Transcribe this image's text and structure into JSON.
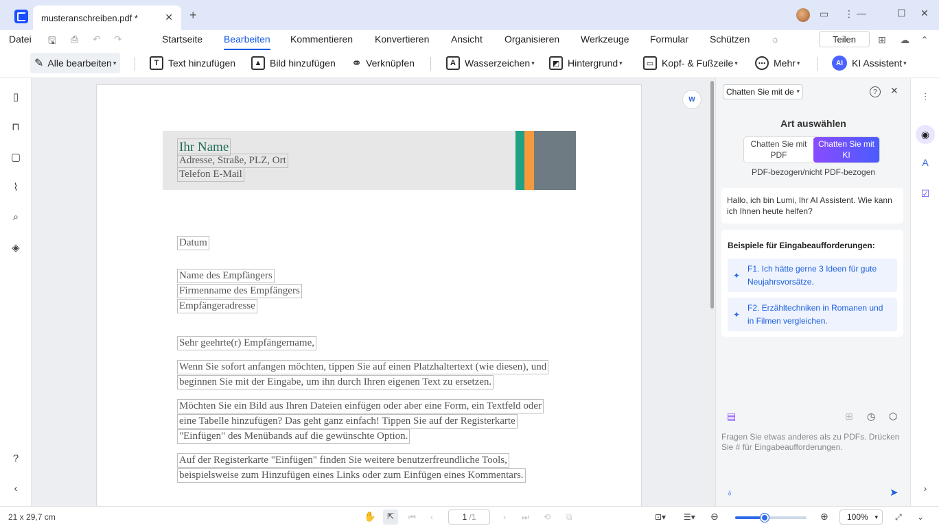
{
  "titlebar": {
    "tab_title": "musteranschreiben.pdf *",
    "tab_close": "✕",
    "new_tab": "+",
    "window": {
      "minimize": "—",
      "maximize": "☐",
      "close": "✕"
    }
  },
  "menubar": {
    "file": "Datei",
    "tabs": [
      "Startseite",
      "Bearbeiten",
      "Kommentieren",
      "Konvertieren",
      "Ansicht",
      "Organisieren",
      "Werkzeuge",
      "Formular",
      "Schützen"
    ],
    "active_tab": "Bearbeiten",
    "share": "Teilen"
  },
  "toolbar": {
    "edit_all": "Alle bearbeiten",
    "add_text": "Text hinzufügen",
    "add_image": "Bild hinzufügen",
    "link": "Verknüpfen",
    "watermark": "Wasserzeichen",
    "background": "Hintergrund",
    "header_footer": "Kopf- & Fußzeile",
    "more": "Mehr",
    "ai_badge": "AI",
    "ai_assistant": "KI Assistent"
  },
  "document": {
    "name": "Ihr Name",
    "address": "Adresse, Straße, PLZ, Ort",
    "contact": "Telefon  E-Mail",
    "date": "Datum",
    "recipient_name": "Name des Empfängers",
    "recipient_company": "Firmenname des Empfängers",
    "recipient_address": "Empfängeradresse",
    "salutation": "Sehr geehrte(r) Empfängername,",
    "p1_l1": "Wenn Sie sofort anfangen möchten, tippen Sie auf einen Platzhaltertext (wie diesen), und",
    "p1_l2": "beginnen Sie mit der Eingabe, um ihn durch Ihren eigenen Text zu ersetzen.",
    "p2_l1": "Möchten Sie ein Bild aus Ihren Dateien einfügen oder aber eine Form, ein Textfeld oder",
    "p2_l2": "eine Tabelle hinzufügen? Das geht ganz einfach! Tippen Sie auf der Registerkarte",
    "p2_l3": "\"Einfügen\" des Menübands auf die gewünschte Option.",
    "p3_l1": "Auf der Registerkarte \"Einfügen\" finden Sie weitere benutzerfreundliche Tools,",
    "p3_l2": "beispielsweise zum Hinzufügen eines Links oder zum Einfügen eines Kommentars."
  },
  "ai_panel": {
    "select_value": "Chatten Sie mit de",
    "title": "Art auswählen",
    "mode_pdf": "Chatten Sie mit PDF",
    "mode_ki": "Chatten Sie mit KI",
    "subtitle": "PDF-bezogen/nicht PDF-bezogen",
    "greeting": "Hallo, ich bin Lumi, Ihr AI Assistent. Wie kann ich Ihnen heute helfen?",
    "examples_title": "Beispiele für Eingabeaufforderungen:",
    "example_1": "F1. Ich hätte gerne 3 Ideen für gute Neujahrsvorsätze.",
    "example_2": "F2. Erzähltechniken in Romanen und in Filmen vergleichen.",
    "input_placeholder": "Fragen Sie etwas anderes als zu PDFs. Drücken Sie # für Eingabeaufforderungen."
  },
  "statusbar": {
    "page_size": "21 x 29,7 cm",
    "page_current": "1",
    "page_total": "/1",
    "zoom": "100%",
    "zoom_fraction": 0.41
  }
}
